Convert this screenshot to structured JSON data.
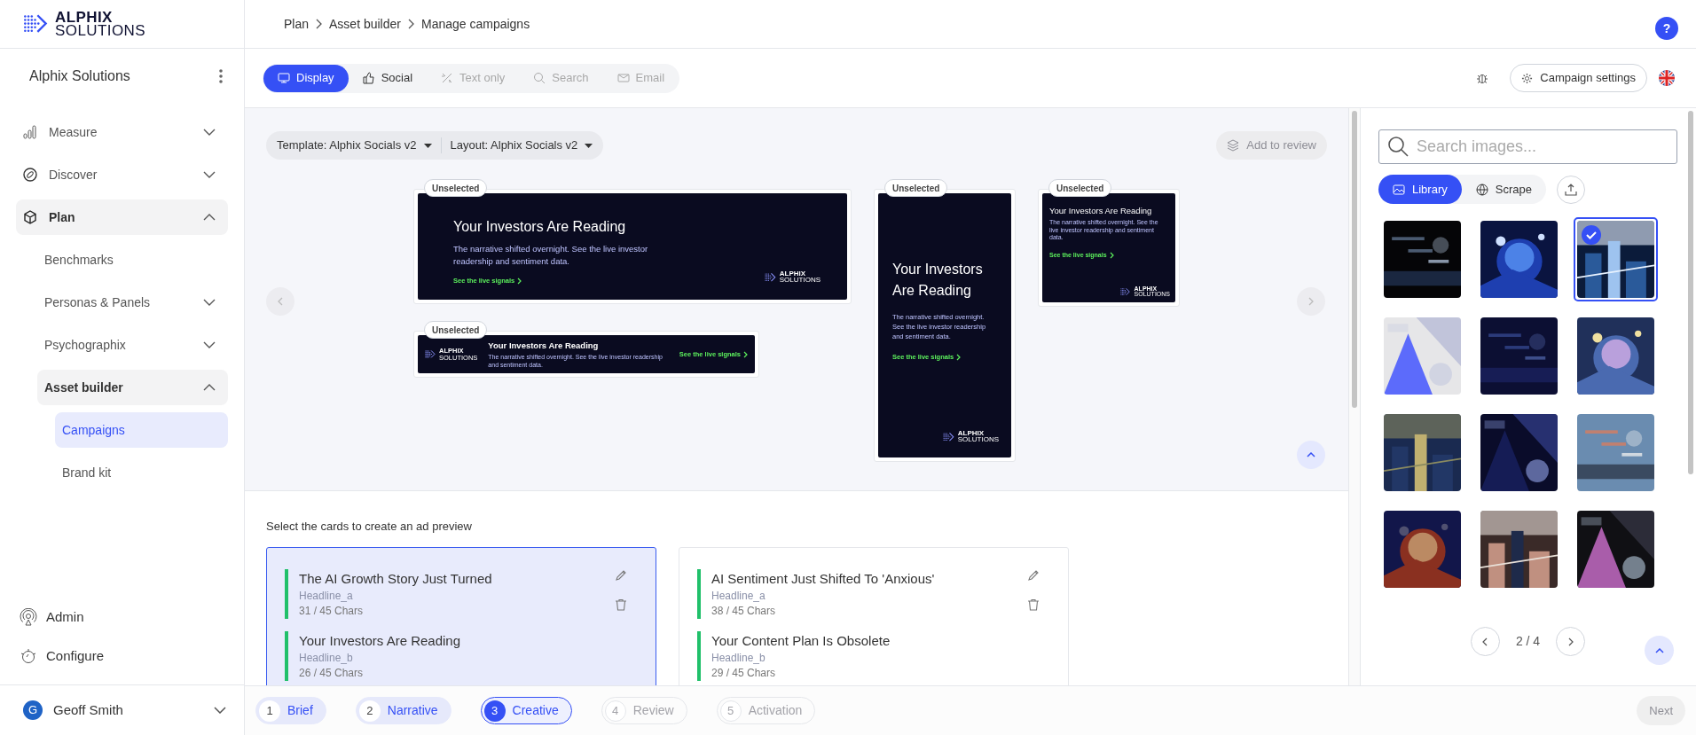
{
  "logo": {
    "line1": "ALPHIX",
    "line2": "SOLUTIONS"
  },
  "workspace": "Alphix Solutions",
  "nav": [
    {
      "label": "Measure",
      "expanded": false
    },
    {
      "label": "Discover",
      "expanded": false
    },
    {
      "label": "Plan",
      "expanded": true,
      "children": [
        {
          "label": "Benchmarks"
        },
        {
          "label": "Personas & Panels",
          "expanded": false
        },
        {
          "label": "Psychographix",
          "expanded": false
        },
        {
          "label": "Asset builder",
          "expanded": true,
          "children": [
            {
              "label": "Campaigns",
              "selected": true
            },
            {
              "label": "Brand kit",
              "selected": false
            }
          ]
        }
      ]
    }
  ],
  "footer_nav": [
    {
      "label": "Admin"
    },
    {
      "label": "Configure"
    }
  ],
  "user": {
    "initial": "G",
    "name": "Geoff Smith"
  },
  "breadcrumb": [
    "Plan",
    "Asset builder",
    "Manage campaigns"
  ],
  "help": "?",
  "channel_tabs": [
    {
      "label": "Display",
      "selected": true,
      "disabled": false
    },
    {
      "label": "Social",
      "selected": false,
      "disabled": false
    },
    {
      "label": "Text only",
      "selected": false,
      "disabled": true
    },
    {
      "label": "Search",
      "selected": false,
      "disabled": true
    },
    {
      "label": "Email",
      "selected": false,
      "disabled": true
    }
  ],
  "campaign_settings": "Campaign settings",
  "template": "Template: Alphix Socials v2",
  "layout": "Layout: Alphix Socials v2",
  "add_to_review": {
    "label": "Add to review",
    "disabled": true
  },
  "previews": [
    {
      "kind": "leaderboard",
      "badge": "Unselected",
      "headline": "Your Investors Are Reading",
      "body": "The narrative shifted overnight. See the live investor readership and sentiment data.",
      "cta": "See the live signals",
      "logo_line1": "ALPHIX",
      "logo_line2": "SOLUTIONS"
    },
    {
      "kind": "banner",
      "badge": "Unselected",
      "headline": "Your Investors Are Reading",
      "body": "The narrative shifted overnight. See the live investor readership and sentiment data.",
      "cta": "See the live signals",
      "logo_line1": "ALPHIX",
      "logo_line2": "SOLUTIONS"
    },
    {
      "kind": "skyscraper",
      "badge": "Unselected",
      "headline": "Your Investors Are Reading",
      "body": "The narrative shifted overnight. See the live investor readership and sentiment data.",
      "cta": "See the live signals",
      "logo_line1": "ALPHIX",
      "logo_line2": "SOLUTIONS"
    },
    {
      "kind": "square",
      "badge": "Unselected",
      "headline": "Your Investors Are Reading",
      "body": "The narrative shifted overnight. See the live investor readership and sentiment data.",
      "cta": "See the live signals",
      "logo_line1": "ALPHIX",
      "logo_line2": "SOLUTIONS"
    }
  ],
  "cards_hint": "Select the cards to create an ad preview",
  "headline_cards": [
    {
      "selected": true,
      "fields": [
        {
          "text": "The AI Growth Story Just Turned",
          "name": "Headline_a",
          "count": "31 / 45 Chars"
        },
        {
          "text": "Your Investors Are Reading",
          "name": "Headline_b",
          "count": "26 / 45 Chars"
        }
      ]
    },
    {
      "selected": false,
      "fields": [
        {
          "text": "AI Sentiment Just Shifted To 'Anxious'",
          "name": "Headline_a",
          "count": "38 / 45 Chars"
        },
        {
          "text": "Your Content Plan Is Obsolete",
          "name": "Headline_b",
          "count": "29 / 45 Chars"
        }
      ]
    }
  ],
  "image_search": {
    "placeholder": "Search images..."
  },
  "image_tabs": [
    {
      "label": "Library",
      "selected": true
    },
    {
      "label": "Scrape",
      "selected": false
    }
  ],
  "images": [
    {
      "selected": false
    },
    {
      "selected": false
    },
    {
      "selected": true
    },
    {
      "selected": false
    },
    {
      "selected": false
    },
    {
      "selected": false
    },
    {
      "selected": false
    },
    {
      "selected": false
    },
    {
      "selected": false
    },
    {
      "selected": false
    },
    {
      "selected": false
    },
    {
      "selected": false
    }
  ],
  "pagination": "2 / 4",
  "steps": [
    {
      "number": "1",
      "label": "Brief",
      "selected": false,
      "disabled": false
    },
    {
      "number": "2",
      "label": "Narrative",
      "selected": false,
      "disabled": false
    },
    {
      "number": "3",
      "label": "Creative",
      "selected": true,
      "disabled": false
    },
    {
      "number": "4",
      "label": "Review",
      "selected": false,
      "disabled": true
    },
    {
      "number": "5",
      "label": "Activation",
      "selected": false,
      "disabled": true
    }
  ],
  "next": {
    "label": "Next",
    "disabled": true
  }
}
